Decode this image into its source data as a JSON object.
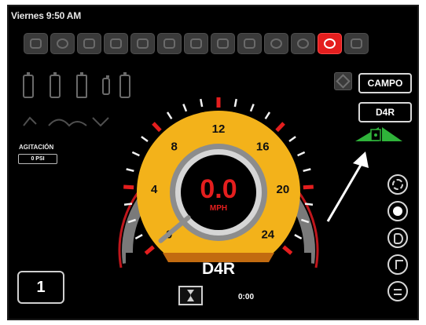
{
  "status_bar": {
    "datetime": "Viernes 9:50 AM"
  },
  "toolbar": {
    "icons": [
      "disc-icon",
      "steering-icon",
      "stop-icon",
      "machine-icon",
      "gauge-icon",
      "flow-icon",
      "valve-icon",
      "grid-icon",
      "boom-icon",
      "pump-icon",
      "settings-icon",
      "alert-icon",
      "more-icon"
    ],
    "active_index": 11
  },
  "agitation": {
    "label": "AGITACIÓN",
    "value": "0 PSI"
  },
  "mode": {
    "field_button": "CAMPO",
    "transmission_button": "D4R"
  },
  "speedometer": {
    "value": "0.0",
    "unit": "MPH",
    "gear": "D4R",
    "scale_labels": [
      "0",
      "4",
      "8",
      "12",
      "16",
      "20",
      "24"
    ],
    "scale_max": 24
  },
  "gear_indicator": "1",
  "timer": "0:00",
  "side_buttons": [
    "fan-icon",
    "light-icon",
    "headlights-icon",
    "music-icon",
    "menu-icon"
  ],
  "colors": {
    "gauge_face": "#f3b21a",
    "needle_text": "#e41e1e",
    "accent": "#e41e1e",
    "slope_indicator": "#2fb33a"
  }
}
